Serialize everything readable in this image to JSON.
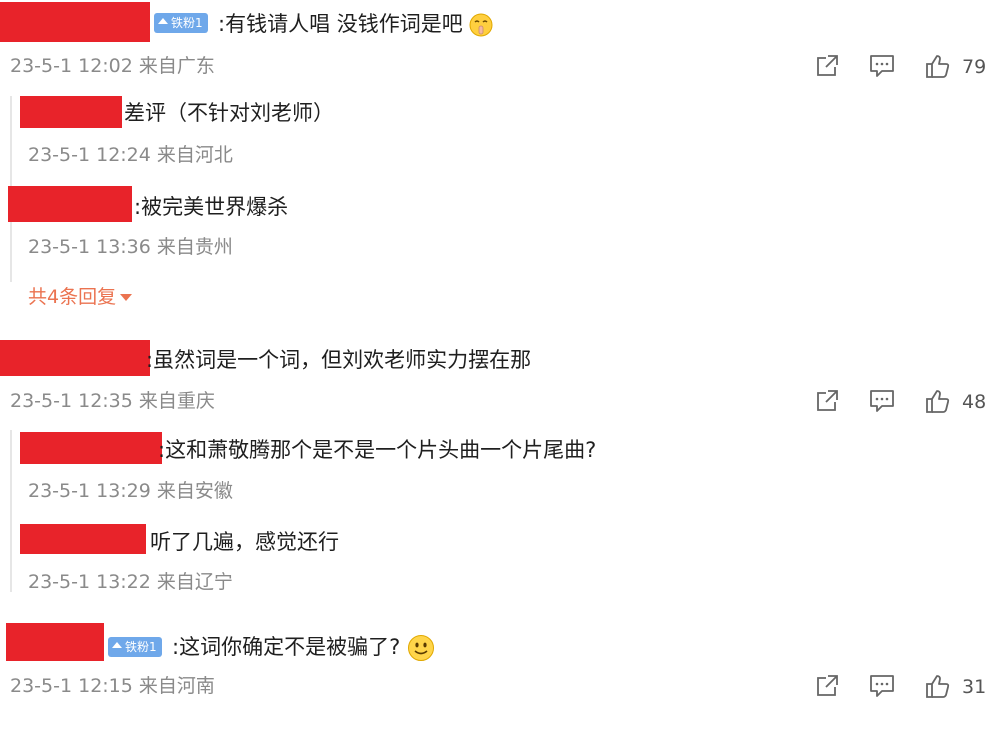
{
  "comments": [
    {
      "badge": "铁粉1",
      "text": ":有钱请人唱 没钱作词是吧",
      "meta": "23-5-1 12:02 来自广东",
      "likes": "79",
      "replies": [
        {
          "text": "差评（不针对刘老师）",
          "meta": "23-5-1 12:24 来自河北"
        },
        {
          "text": ":被完美世界爆杀",
          "meta": "23-5-1 13:36 来自贵州"
        }
      ],
      "more": "共4条回复"
    },
    {
      "text": ":虽然词是一个词，但刘欢老师实力摆在那",
      "meta": "23-5-1 12:35 来自重庆",
      "likes": "48",
      "replies": [
        {
          "text": ":这和萧敬腾那个是不是一个片头曲一个片尾曲?",
          "meta": "23-5-1 13:29 来自安徽"
        },
        {
          "text": "听了几遍，感觉还行",
          "meta": "23-5-1 13:22 来自辽宁"
        }
      ]
    },
    {
      "badge": "铁粉1",
      "text": ":这词你确定不是被骗了?",
      "meta": "23-5-1 12:15 来自河南",
      "likes": "31"
    }
  ],
  "icons": {
    "share": "share-icon",
    "comment": "comment-icon",
    "like": "thumbs-up-icon"
  }
}
